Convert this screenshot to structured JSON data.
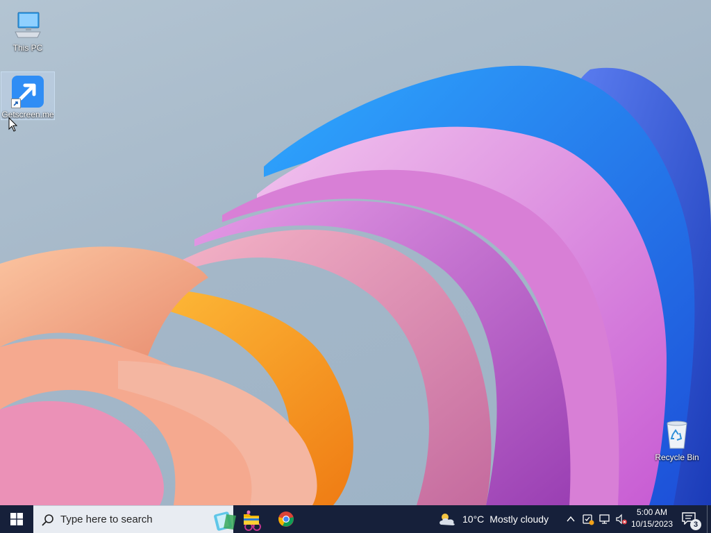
{
  "desktop": {
    "icons": [
      {
        "label": "This PC",
        "icon": "computer-icon"
      },
      {
        "label": "Getscreen.me",
        "icon": "getscreen-shortcut-icon"
      },
      {
        "label": "Recycle Bin",
        "icon": "recycle-bin-icon"
      }
    ]
  },
  "taskbar": {
    "start_icon": "windows-logo-icon",
    "search": {
      "placeholder": "Type here to search",
      "icon": "search-icon"
    },
    "apps": [
      {
        "name": "File Explorer",
        "icon": "folder-icon"
      },
      {
        "name": "Google Chrome",
        "icon": "chrome-icon"
      }
    ],
    "weather": {
      "temperature": "10°C",
      "condition": "Mostly cloudy",
      "icon": "partly-cloudy-icon"
    },
    "tray": {
      "icons": [
        "chevron-up-icon",
        "security-warning-icon",
        "network-disconnected-icon",
        "speaker-muted-icon"
      ]
    },
    "clock": {
      "time": "5:00 AM",
      "date": "10/15/2023"
    },
    "notifications": {
      "count": "3",
      "icon": "notification-icon"
    }
  },
  "colors": {
    "taskbar": "#16203a",
    "search_box": "#e8ecf2",
    "accent": "#0078d4"
  }
}
